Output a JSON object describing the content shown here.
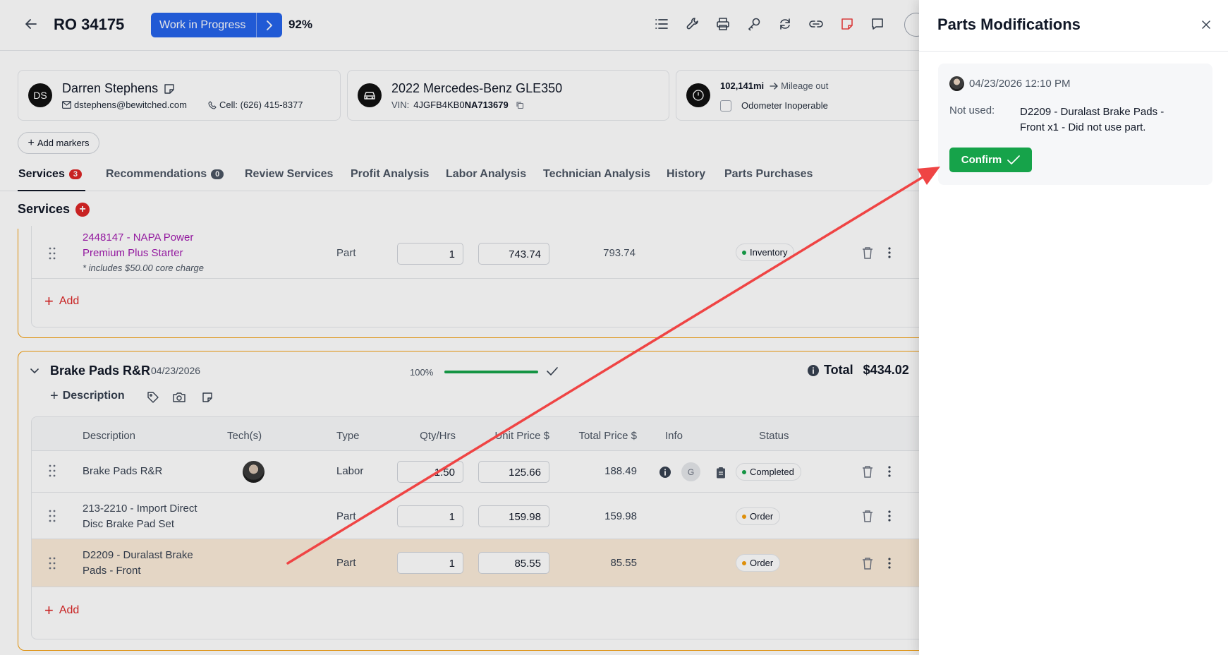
{
  "header": {
    "ro_number": "RO 34175",
    "status": "Work in Progress",
    "progress_percent": "92%"
  },
  "customer": {
    "initials": "DS",
    "name": "Darren Stephens",
    "email": "dstephens@bewitched.com",
    "phone": "Cell: (626) 415-8377"
  },
  "vehicle": {
    "name": "2022 Mercedes-Benz GLE350",
    "vin_label": "VIN:",
    "vin_prefix": "4JGFB4KB0",
    "vin_suffix": "NA713679"
  },
  "mileage": {
    "value": "102,141mi",
    "out_label": "Mileage out",
    "odometer_label": "Odometer Inoperable"
  },
  "markers_label": "Add markers",
  "tabs": [
    {
      "label": "Services",
      "badge": "3"
    },
    {
      "label": "Recommendations",
      "badge": "0"
    },
    {
      "label": "Review Services"
    },
    {
      "label": "Profit Analysis"
    },
    {
      "label": "Labor Analysis"
    },
    {
      "label": "Technician Analysis"
    },
    {
      "label": "History"
    },
    {
      "label": "Parts Purchases"
    }
  ],
  "services_heading": "Services",
  "service1": {
    "part_line1": "2448147 - NAPA Power",
    "part_line2": "Premium Plus Starter",
    "note": "* includes $50.00 core charge",
    "type": "Part",
    "qty": "1",
    "unit_price": "743.74",
    "total": "793.74",
    "status": "Inventory",
    "add_label": "Add"
  },
  "service2": {
    "title": "Brake Pads R&R",
    "date": "04/23/2026",
    "progress": "100%",
    "progress_fraction": 1.0,
    "total_label": "Total",
    "total_value": "$434.02",
    "description_label": "Description",
    "columns": [
      "Description",
      "Tech(s)",
      "Type",
      "Qty/Hrs",
      "Unit Price $",
      "Total Price $",
      "Info",
      "Status"
    ],
    "rows": [
      {
        "line1": "Brake Pads R&R",
        "line2": "",
        "type": "Labor",
        "qty": "1.50",
        "unit": "125.66",
        "total": "188.49",
        "info_g": "G",
        "status": "Completed",
        "status_color": "#16a34a"
      },
      {
        "line1": "213-2210 - Import Direct",
        "line2": "Disc Brake Pad Set",
        "type": "Part",
        "qty": "1",
        "unit": "159.98",
        "total": "159.98",
        "status": "Order",
        "status_color": "#f59e0b"
      },
      {
        "line1": "D2209 - Duralast Brake",
        "line2": "Pads - Front",
        "type": "Part",
        "qty": "1",
        "unit": "85.55",
        "total": "85.55",
        "status": "Order",
        "status_color": "#f59e0b"
      }
    ],
    "add_label": "Add"
  },
  "drawer": {
    "title": "Parts Modifications",
    "timestamp": "04/23/2026 12:10 PM",
    "label": "Not used:",
    "text_line1": "D2209 - Duralast Brake Pads -",
    "text_line2": "Front x1 - Did not use part.",
    "confirm_label": "Confirm"
  },
  "colors": {
    "status_blue": "#2563eb",
    "confirm_green": "#16a34a",
    "accent_red": "#dc2626",
    "service_border": "#f59e0b",
    "part_link": "#a21caf",
    "annotation_arrow": "#ef4444"
  }
}
